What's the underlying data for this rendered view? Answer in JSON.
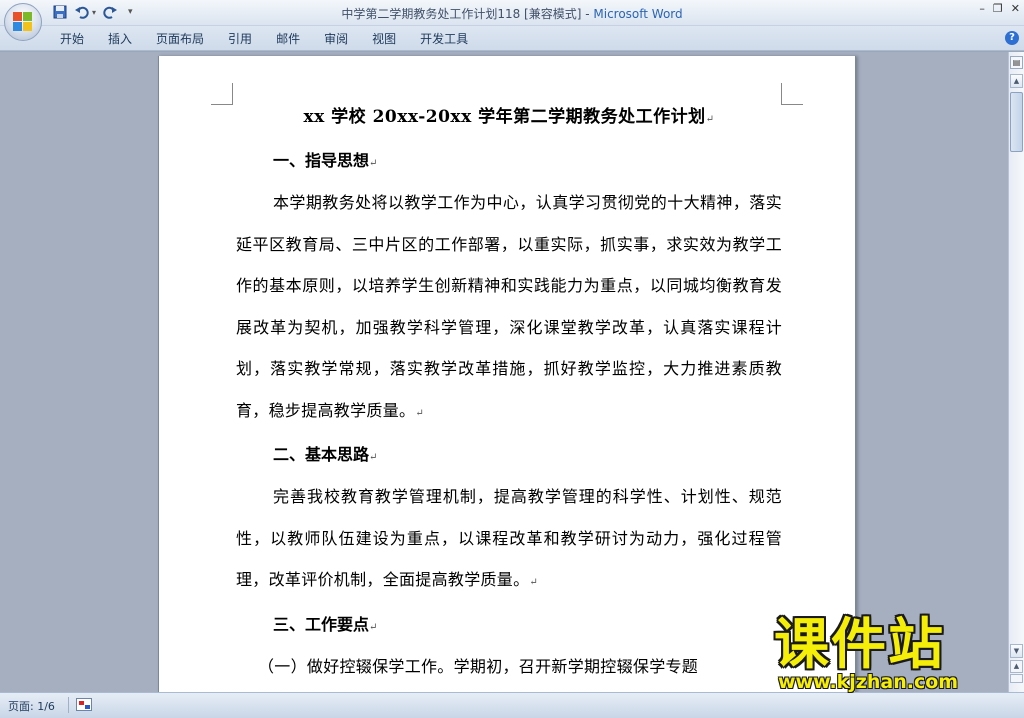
{
  "window": {
    "title_doc": "中学第二学期教务处工作计划118 [兼容模式] - ",
    "title_app": "Microsoft Word"
  },
  "ribbon": {
    "tabs": [
      "开始",
      "插入",
      "页面布局",
      "引用",
      "邮件",
      "审阅",
      "视图",
      "开发工具"
    ]
  },
  "document": {
    "title": "xx 学校 20xx-20xx 学年第二学期教务处工作计划",
    "sections": [
      {
        "heading": "一、指导思想",
        "paragraph": "本学期教务处将以教学工作为中心，认真学习贯彻党的十大精神，落实延平区教育局、三中片区的工作部署，以重实际，抓实事，求实效为教学工作的基本原则，以培养学生创新精神和实践能力为重点，以同城均衡教育发展改革为契机，加强教学科学管理，深化课堂教学改革，认真落实课程计划，落实教学常规，落实教学改革措施，抓好教学监控，大力推进素质教育，稳步提高教学质量。"
      },
      {
        "heading": "二、基本思路",
        "paragraph": "完善我校教育教学管理机制，提高教学管理的科学性、计划性、规范性，以教师队伍建设为重点，以课程改革和教学研讨为动力，强化过程管理，改革评价机制，全面提高教学质量。"
      },
      {
        "heading": "三、工作要点",
        "paragraph": "（一）做好控辍保学工作。学期初，召开新学期控辍保学专题"
      }
    ],
    "paragraph_mark": "↵"
  },
  "status": {
    "page": "页面: 1/6"
  },
  "watermark": {
    "text": "课件站",
    "url": "www.kjzhan.com"
  }
}
